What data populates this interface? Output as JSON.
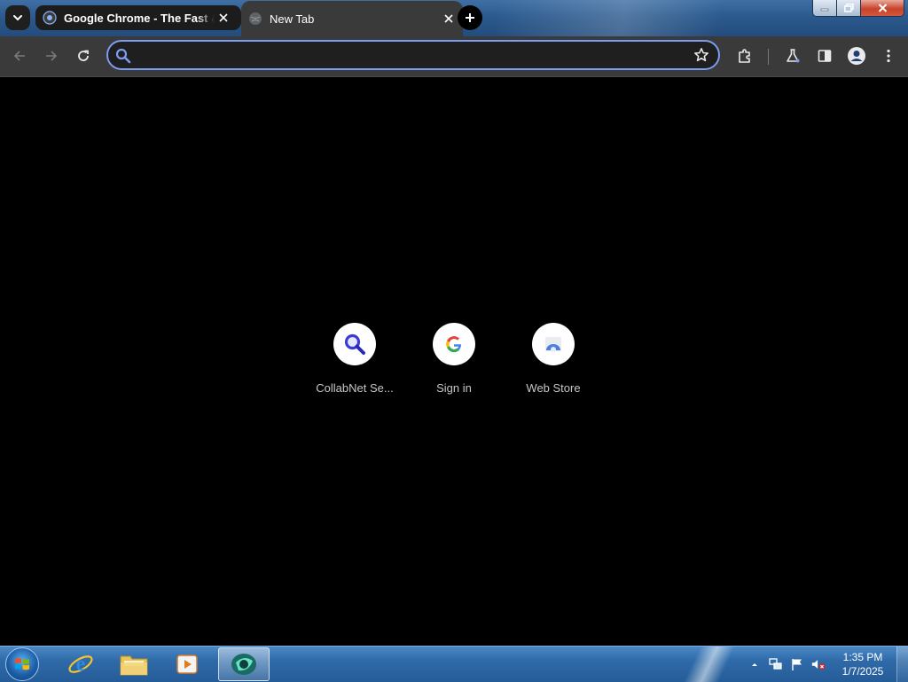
{
  "window": {
    "tabs": [
      {
        "title": "Google Chrome - The Fast & Secure Web Browser Built to be Yours",
        "favicon": "chrome-icon",
        "active": false
      },
      {
        "title": "New Tab",
        "favicon": "globe-icon",
        "active": true
      }
    ],
    "controls": [
      "minimize-icon",
      "restore-icon",
      "close-icon"
    ]
  },
  "toolbar": {
    "omnibox": {
      "value": "",
      "placeholder": ""
    },
    "buttons": [
      "back-arrow-icon",
      "forward-arrow-icon",
      "reload-icon",
      "star-icon",
      "extensions-icon",
      "labs-flask-icon",
      "side-panel-icon",
      "profile-avatar-icon",
      "more-menu-icon"
    ]
  },
  "ntp": {
    "shortcuts": [
      {
        "label": "CollabNet Se...",
        "icon": "magnifier-icon"
      },
      {
        "label": "Sign in",
        "icon": "google-g-icon"
      },
      {
        "label": "Web Store",
        "icon": "web-store-icon"
      }
    ]
  },
  "taskbar": {
    "pinned": [
      "internet-explorer-icon",
      "file-explorer-icon",
      "media-player-icon",
      "chrome-running-icon"
    ],
    "clock": {
      "time": "1:35 PM",
      "date": "1/7/2025"
    },
    "tray": [
      "show-hidden-icons-arrow",
      "network-icon",
      "action-center-flag-icon",
      "volume-muted-icon"
    ]
  },
  "colors": {
    "accent": "#7b9cf0",
    "tab_strip": "#2c5a8e",
    "toolbar": "#3a3a3a",
    "ntp_background": "#000000"
  }
}
